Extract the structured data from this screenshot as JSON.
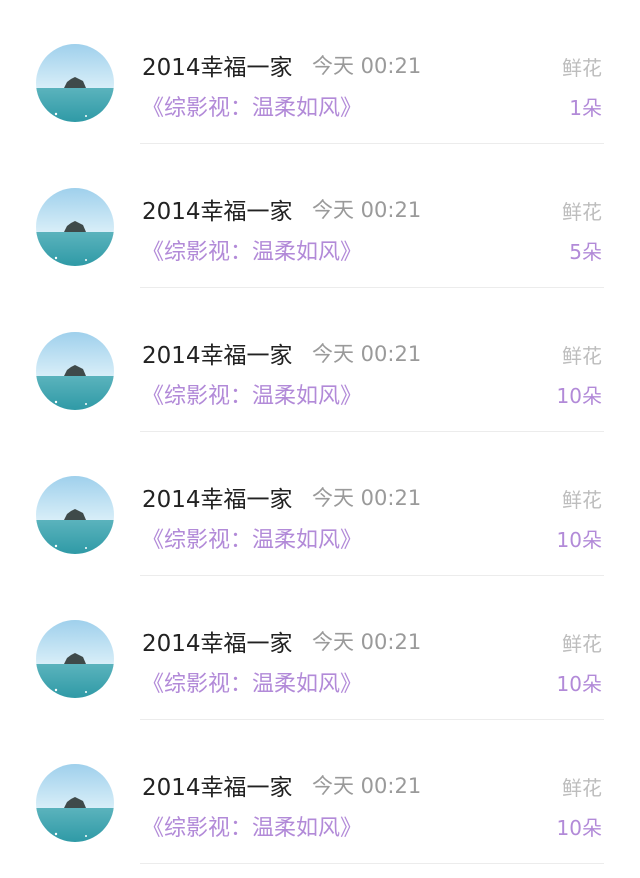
{
  "colors": {
    "name": "#222222",
    "time": "#9a9a9a",
    "gift_label": "#bdbdbd",
    "accent_purple": "#b28ad8",
    "divider": "#ececec"
  },
  "rows": [
    {
      "name": "2014幸福一家",
      "time": "今天 00:21",
      "gift_label": "鲜花",
      "work": "《综影视：温柔如风》",
      "count": "1朵",
      "avatar": "island-sea-photo"
    },
    {
      "name": "2014幸福一家",
      "time": "今天 00:21",
      "gift_label": "鲜花",
      "work": "《综影视：温柔如风》",
      "count": "5朵",
      "avatar": "island-sea-photo"
    },
    {
      "name": "2014幸福一家",
      "time": "今天 00:21",
      "gift_label": "鲜花",
      "work": "《综影视：温柔如风》",
      "count": "10朵",
      "avatar": "island-sea-photo"
    },
    {
      "name": "2014幸福一家",
      "time": "今天 00:21",
      "gift_label": "鲜花",
      "work": "《综影视：温柔如风》",
      "count": "10朵",
      "avatar": "island-sea-photo"
    },
    {
      "name": "2014幸福一家",
      "time": "今天 00:21",
      "gift_label": "鲜花",
      "work": "《综影视：温柔如风》",
      "count": "10朵",
      "avatar": "island-sea-photo"
    },
    {
      "name": "2014幸福一家",
      "time": "今天 00:21",
      "gift_label": "鲜花",
      "work": "《综影视：温柔如风》",
      "count": "10朵",
      "avatar": "island-sea-photo"
    }
  ]
}
